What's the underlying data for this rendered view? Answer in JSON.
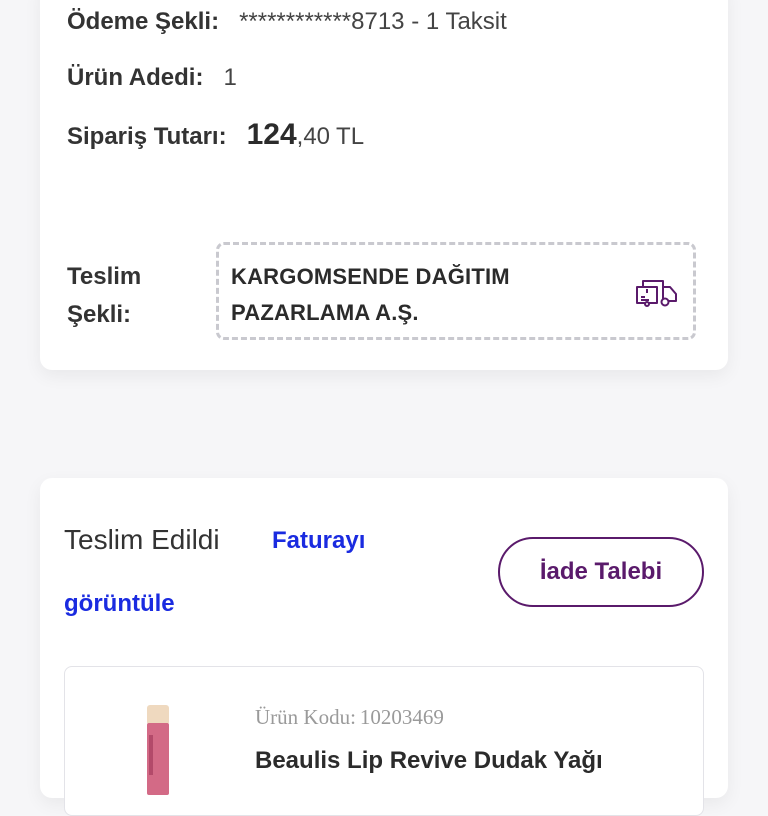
{
  "order_summary": {
    "payment": {
      "label": "Ödeme Şekli:",
      "value": "************8713 - 1 Taksit"
    },
    "quantity": {
      "label": "Ürün Adedi:",
      "value": "1"
    },
    "total": {
      "label": "Sipariş Tutarı:",
      "amount_main": "124",
      "amount_fraction": ",40",
      "currency": "TL"
    },
    "delivery": {
      "label": "Teslim Şekli:",
      "carrier": "KARGOMSENDE DAĞITIM PAZARLAMA A.Ş.",
      "icon": "truck-icon"
    }
  },
  "shipment": {
    "status": "Teslim Edildi",
    "invoice_link_line1": "Faturayı",
    "invoice_link_line2": "görüntüle",
    "return_button": "İade Talebi",
    "product": {
      "code_label": "Ürün Kodu:",
      "code_value": "10203469",
      "name": "Beaulis Lip Revive Dudak Yağı"
    }
  },
  "colors": {
    "brand_purple": "#5a1a6b",
    "link_blue": "#1a2be0",
    "dashed_border": "#c9c9cf"
  }
}
